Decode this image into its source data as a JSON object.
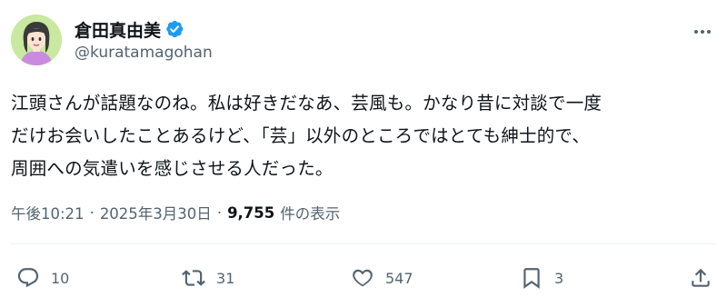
{
  "author": {
    "name": "倉田真由美",
    "handle": "@kuratamagohan",
    "verified": true
  },
  "tweet": {
    "lines": [
      "江頭さんが話題なのね。私は好きだなあ、芸風も。かなり昔に対談で一度",
      "だけお会いしたことあるけど、「芸」以外のところではとても紳士的で、",
      "周囲への気遣いを感じさせる人だった。"
    ]
  },
  "meta": {
    "time": "午後10:21",
    "separator": "·",
    "date": "2025年3月30日",
    "views_count": "9,755",
    "views_label": "件の表示"
  },
  "actions": {
    "replies": "10",
    "reposts": "31",
    "likes": "547",
    "bookmarks": "3"
  },
  "colors": {
    "text": "#0f1419",
    "secondary": "#536471",
    "verified_blue": "#1d9bf0",
    "avatar_bg": "#c9e8a0"
  },
  "icons": [
    "verified-badge-icon",
    "more-icon",
    "reply-icon",
    "repost-icon",
    "like-icon",
    "bookmark-icon",
    "share-icon"
  ]
}
